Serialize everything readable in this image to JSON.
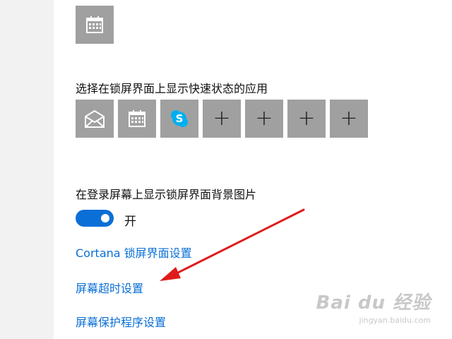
{
  "lock_screen": {
    "quick_status_heading": "选择在锁屏界面上显示快速状态的应用",
    "detailed_status_app": {
      "icon": "calendar-icon"
    },
    "quick_status_apps": [
      {
        "icon": "mail-icon"
      },
      {
        "icon": "calendar-icon"
      },
      {
        "icon": "skype-icon",
        "glyph": "S"
      },
      {
        "icon": "add-icon",
        "glyph": "+"
      },
      {
        "icon": "add-icon",
        "glyph": "+"
      },
      {
        "icon": "add-icon",
        "glyph": "+"
      },
      {
        "icon": "add-icon",
        "glyph": "+"
      }
    ],
    "background_on_signin": {
      "heading": "在登录屏幕上显示锁屏界面背景图片",
      "toggle_state": "开",
      "is_on": true
    },
    "links": {
      "cortana": "Cortana 锁屏界面设置",
      "screen_timeout": "屏幕超时设置",
      "screen_saver": "屏幕保护程序设置"
    }
  },
  "watermark": {
    "main": "Bai du 经验",
    "sub": "jingyan.baidu.com"
  },
  "colors": {
    "tile": "#a0a0a0",
    "accent": "#0a6fd6",
    "arrow": "#e01b1b",
    "sidebar": "#f2f2f2"
  }
}
